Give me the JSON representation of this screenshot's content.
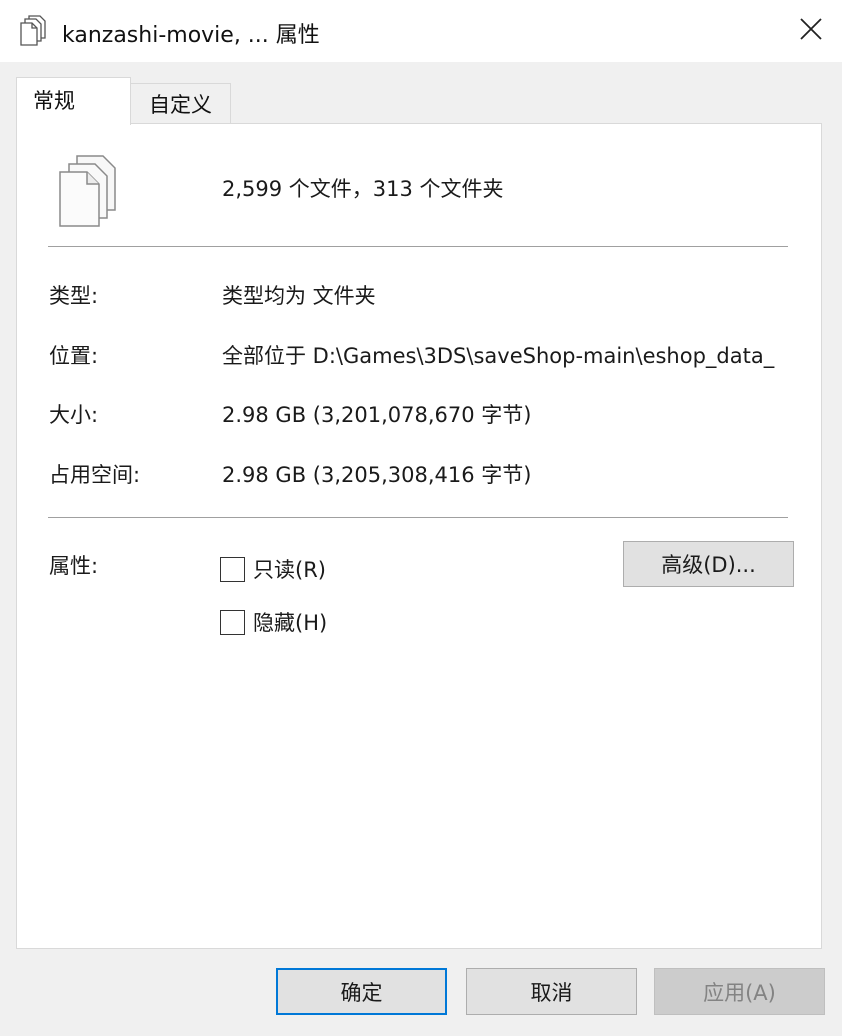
{
  "window": {
    "title": "kanzashi-movie, ... 属性",
    "title_icon": "multiple-files-icon",
    "close_icon": "close-icon"
  },
  "tabs": [
    {
      "label": "常规",
      "selected": true
    },
    {
      "label": "自定义",
      "selected": false
    }
  ],
  "general": {
    "icon": "multiple-files-icon",
    "summary": "2,599 个文件，313 个文件夹",
    "fields": {
      "type_label": "类型:",
      "type_value": "类型均为 文件夹",
      "location_label": "位置:",
      "location_value": "全部位于 D:\\Games\\3DS\\saveShop-main\\eshop_data_",
      "size_label": "大小:",
      "size_value": "2.98 GB (3,201,078,670 字节)",
      "disk_label": "占用空间:",
      "disk_value": "2.98 GB (3,205,308,416 字节)"
    },
    "attributes": {
      "label": "属性:",
      "readonly": {
        "label": "只读(R)",
        "checked": false
      },
      "hidden": {
        "label": "隐藏(H)",
        "checked": false
      },
      "advanced_button": "高级(D)..."
    }
  },
  "buttons": {
    "ok": "确定",
    "cancel": "取消",
    "apply": "应用(A)",
    "apply_enabled": false
  },
  "colors": {
    "focus_border": "#0078d7",
    "panel_bg": "#ffffff",
    "dialog_bg": "#f0f0f0",
    "disabled_text": "#838383"
  }
}
